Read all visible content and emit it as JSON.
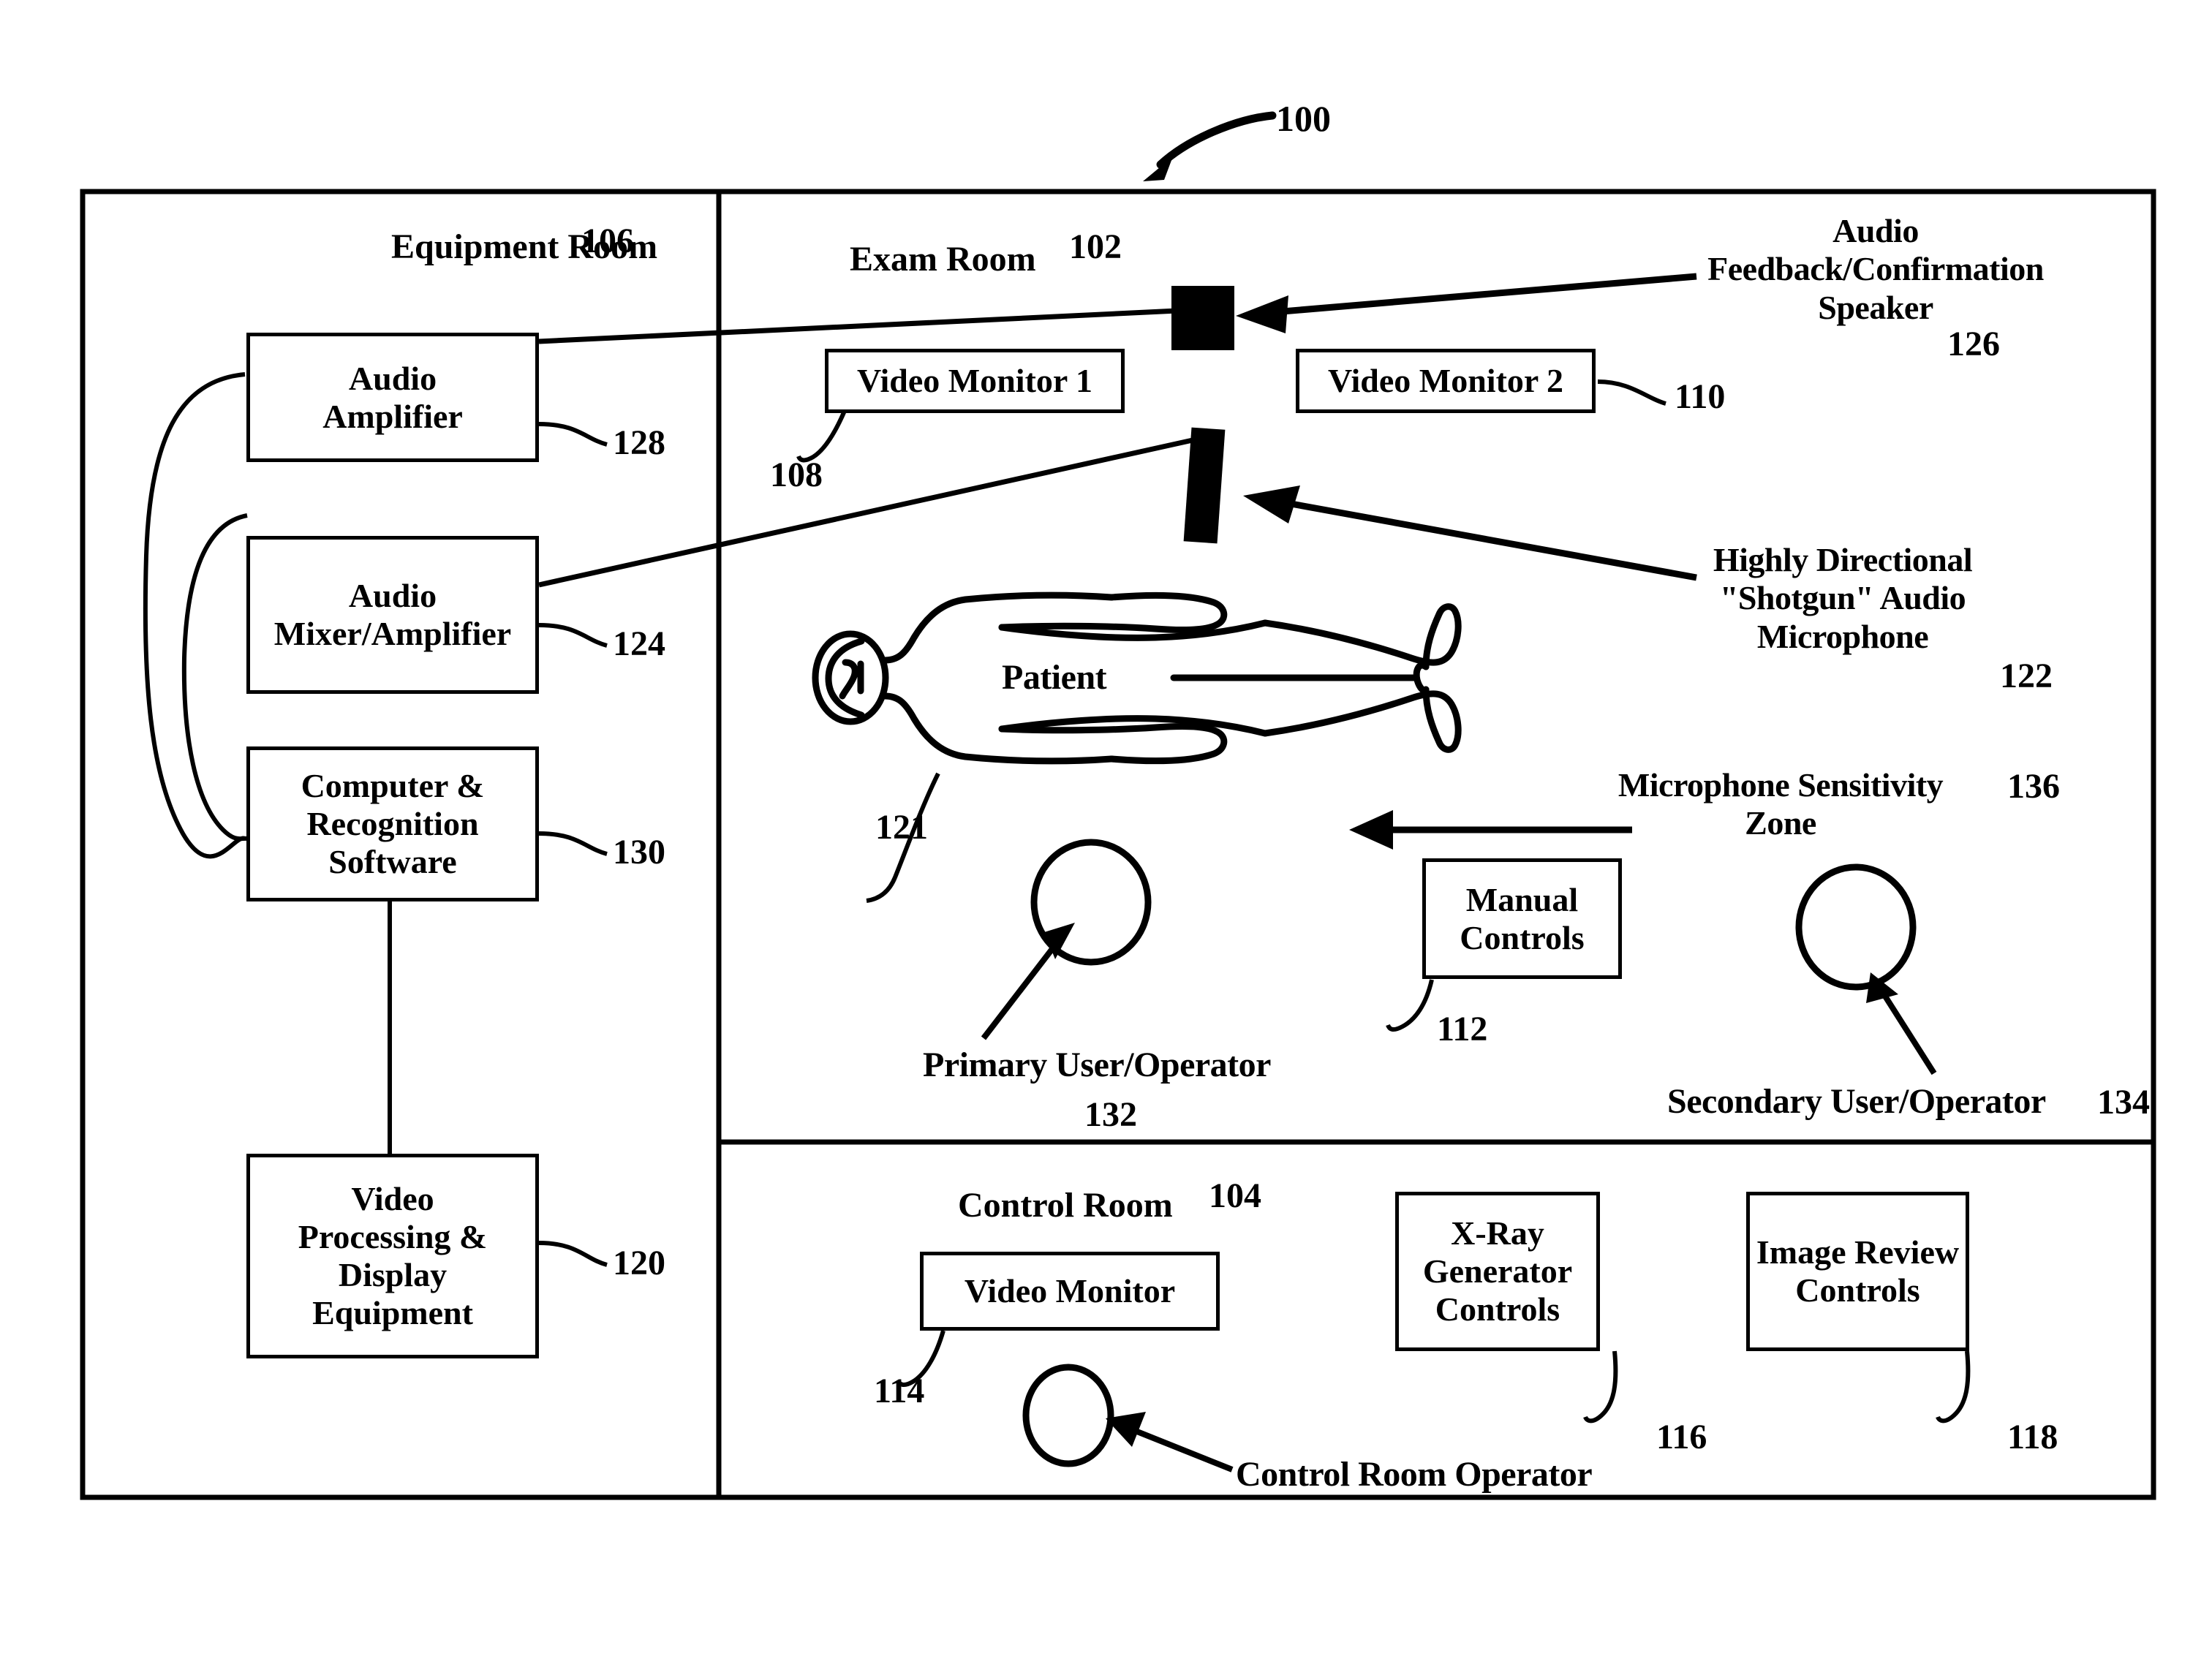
{
  "figure": {
    "number": "100",
    "rooms": {
      "equipment": {
        "title": "Equipment Room",
        "ref": "106"
      },
      "exam": {
        "title": "Exam Room",
        "ref": "102"
      },
      "control": {
        "title": "Control Room",
        "ref": "104"
      }
    }
  },
  "equipment_room": {
    "boxes": [
      {
        "label": "Audio\nAmplifier",
        "ref": "128"
      },
      {
        "label": "Audio\nMixer/Amplifier",
        "ref": "124"
      },
      {
        "label": "Computer &\nRecognition\nSoftware",
        "ref": "130"
      },
      {
        "label": "Video\nProcessing &\nDisplay\nEquipment",
        "ref": "120"
      }
    ]
  },
  "exam_room": {
    "video_monitor_1": {
      "label": "Video Monitor 1",
      "ref": "108"
    },
    "video_monitor_2": {
      "label": "Video Monitor 2",
      "ref": "110"
    },
    "speaker": {
      "label": "Audio\nFeedback/Confirmation\nSpeaker",
      "ref": "126"
    },
    "microphone": {
      "label": "Highly Directional\n\"Shotgun\" Audio\nMicrophone",
      "ref": "122"
    },
    "patient": {
      "label": "Patient",
      "ref": "121"
    },
    "manual_controls": {
      "label": "Manual\nControls",
      "ref": "112"
    },
    "primary_operator": {
      "label": "Primary User/Operator",
      "ref": "132"
    },
    "secondary_operator": {
      "label": "Secondary User/Operator",
      "ref": "134"
    },
    "sensitivity_zone": {
      "label": "Microphone Sensitivity\nZone",
      "ref": "136"
    }
  },
  "control_room": {
    "video_monitor": {
      "label": "Video Monitor",
      "ref": "114"
    },
    "xray_generator_controls": {
      "label": "X-Ray\nGenerator\nControls",
      "ref": "116"
    },
    "image_review_controls": {
      "label": "Image Review\nControls",
      "ref": "118"
    },
    "operator": {
      "label": "Control Room Operator"
    }
  },
  "style": {
    "ink": "#000000",
    "paper": "#ffffff"
  }
}
